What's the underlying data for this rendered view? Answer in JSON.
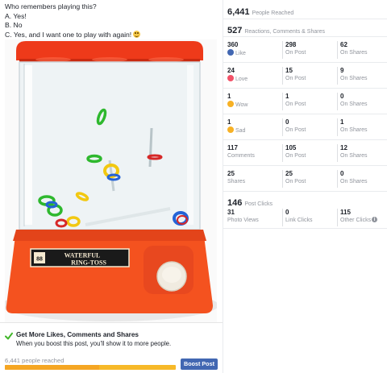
{
  "post": {
    "lines": [
      "Who remembers playing this?",
      "A. Yes!",
      "B. No",
      "C. Yes, and I want one to play with again!"
    ],
    "emoji": "smiley-face"
  },
  "photo": {
    "brand_line1": "WATERFUL",
    "brand_line2": "RING-TOSS",
    "colors": {
      "toy_red": "#ee3a1a",
      "toy_orange": "#f4521f"
    }
  },
  "boost": {
    "title": "Get More Likes, Comments and Shares",
    "description": "When you boost this post, you'll show it to more people.",
    "reached_label": "6,441 people reached",
    "button_label": "Boost Post",
    "progress_fraction": 0.55,
    "colors": {
      "check": "#42b72a",
      "button": "#4267b2",
      "bar": "#f5a623"
    }
  },
  "insights": {
    "people_reached": {
      "value": "6,441",
      "label": "People Reached"
    },
    "engagement": {
      "value": "527",
      "label": "Reactions, Comments & Shares"
    },
    "rows": [
      {
        "icon": "like",
        "color": "#4267b2",
        "cells": [
          {
            "num": "360",
            "label": "Like"
          },
          {
            "num": "298",
            "label": "On Post"
          },
          {
            "num": "62",
            "label": "On Shares"
          }
        ]
      },
      {
        "icon": "love",
        "color": "#f25268",
        "cells": [
          {
            "num": "24",
            "label": "Love"
          },
          {
            "num": "15",
            "label": "On Post"
          },
          {
            "num": "9",
            "label": "On Shares"
          }
        ]
      },
      {
        "icon": "wow",
        "color": "#f7b125",
        "cells": [
          {
            "num": "1",
            "label": "Wow"
          },
          {
            "num": "1",
            "label": "On Post"
          },
          {
            "num": "0",
            "label": "On Shares"
          }
        ]
      },
      {
        "icon": "sad",
        "color": "#f7b125",
        "cells": [
          {
            "num": "1",
            "label": "Sad"
          },
          {
            "num": "0",
            "label": "On Post"
          },
          {
            "num": "1",
            "label": "On Shares"
          }
        ]
      },
      {
        "icon": "",
        "cells": [
          {
            "num": "117",
            "label": "Comments"
          },
          {
            "num": "105",
            "label": "On Post"
          },
          {
            "num": "12",
            "label": "On Shares"
          }
        ]
      },
      {
        "icon": "",
        "cells": [
          {
            "num": "25",
            "label": "Shares"
          },
          {
            "num": "25",
            "label": "On Post"
          },
          {
            "num": "0",
            "label": "On Shares"
          }
        ]
      }
    ],
    "post_clicks": {
      "value": "146",
      "label": "Post Clicks"
    },
    "click_cells": [
      {
        "num": "31",
        "label": "Photo Views"
      },
      {
        "num": "0",
        "label": "Link Clicks"
      },
      {
        "num": "115",
        "label": "Other Clicks"
      }
    ]
  }
}
